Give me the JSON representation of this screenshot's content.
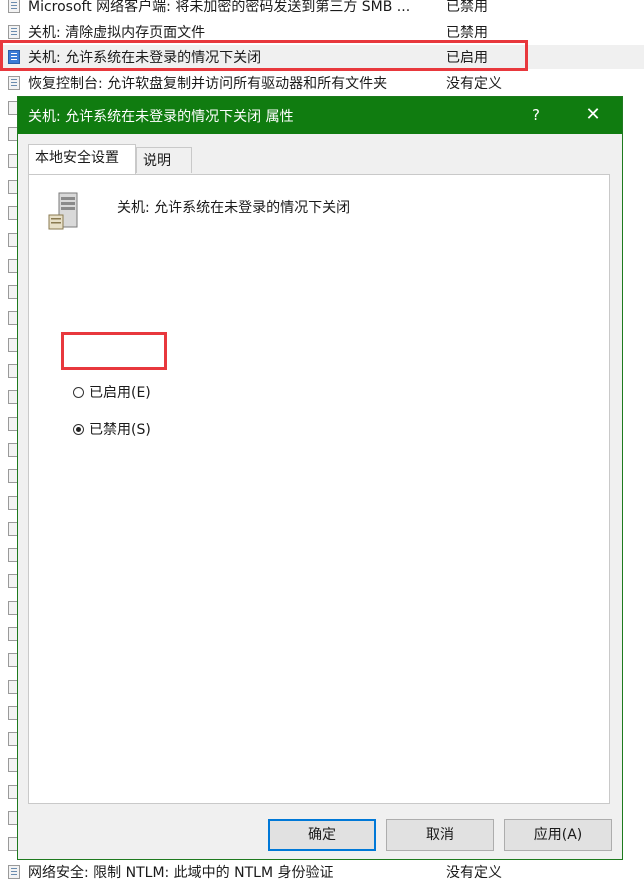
{
  "list": {
    "rows": [
      {
        "name": "Microsoft 网络客户端: 将未加密的密码发送到第三方 SMB ...",
        "state": "已禁用"
      },
      {
        "name": "关机: 清除虚拟内存页面文件",
        "state": "已禁用"
      },
      {
        "name": "关机: 允许系统在未登录的情况下关闭",
        "state": "已启用"
      },
      {
        "name": "恢复控制台: 允许软盘复制并访问所有驱动器和所有文件夹",
        "state": "没有定义"
      }
    ],
    "bottom_row": {
      "name": "网络安全: 限制 NTLM: 此域中的 NTLM 身份验证",
      "state": "没有定义"
    }
  },
  "dialog": {
    "title": "关机: 允许系统在未登录的情况下关闭 属性",
    "help_glyph": "?",
    "close_glyph": "✕",
    "tabs": [
      {
        "label": "本地安全设置"
      },
      {
        "label": "说明"
      }
    ],
    "policy_name": "关机: 允许系统在未登录的情况下关闭",
    "options": {
      "enabled": "已启用(E)",
      "disabled": "已禁用(S)",
      "selected": "disabled"
    },
    "buttons": {
      "ok": "确定",
      "cancel": "取消",
      "apply": "应用(A)"
    }
  },
  "colors": {
    "titlebar": "#107c10",
    "highlight": "#e8383d",
    "default_button_border": "#0078d7"
  }
}
